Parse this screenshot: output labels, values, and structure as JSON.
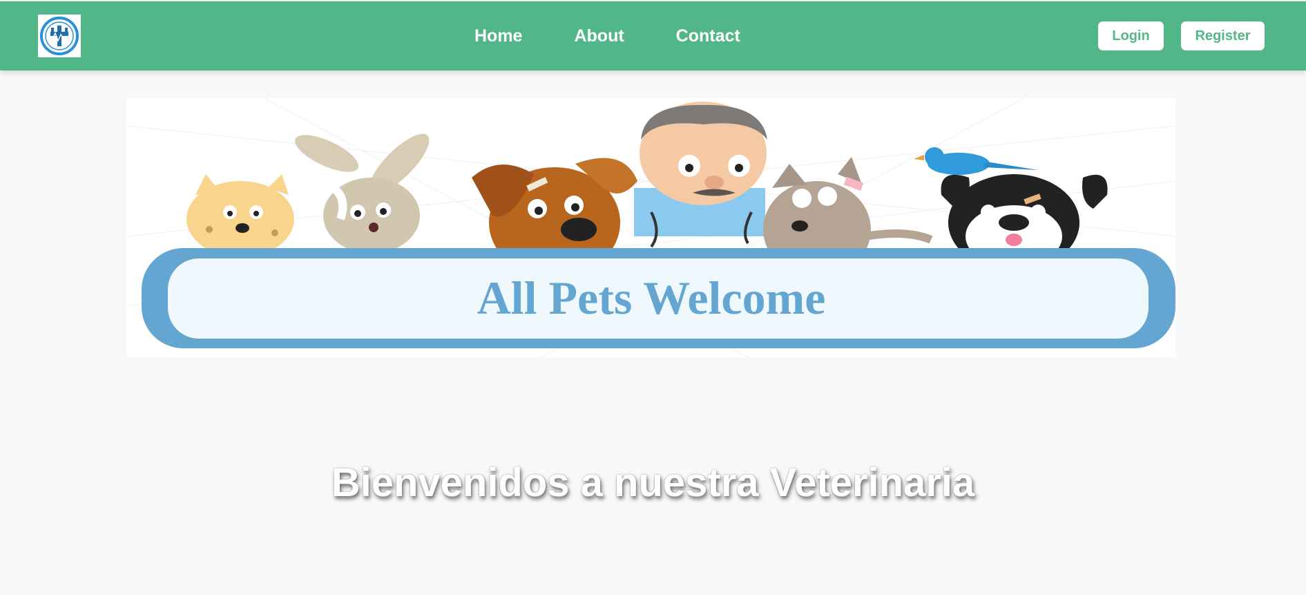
{
  "header": {
    "logo_icon": "vet-clinic-logo-icon",
    "nav": [
      {
        "label": "Home"
      },
      {
        "label": "About"
      },
      {
        "label": "Contact"
      }
    ],
    "login_label": "Login",
    "register_label": "Register"
  },
  "hero": {
    "image_icon": "all-pets-welcome-illustration",
    "banner_text": "All Pets Welcome"
  },
  "main": {
    "welcome_heading": "Bienvenidos a nuestra Veterinaria"
  },
  "colors": {
    "brand_green": "#52b788",
    "page_bg": "#f7f8fa",
    "banner_blue": "#64a6d1"
  }
}
